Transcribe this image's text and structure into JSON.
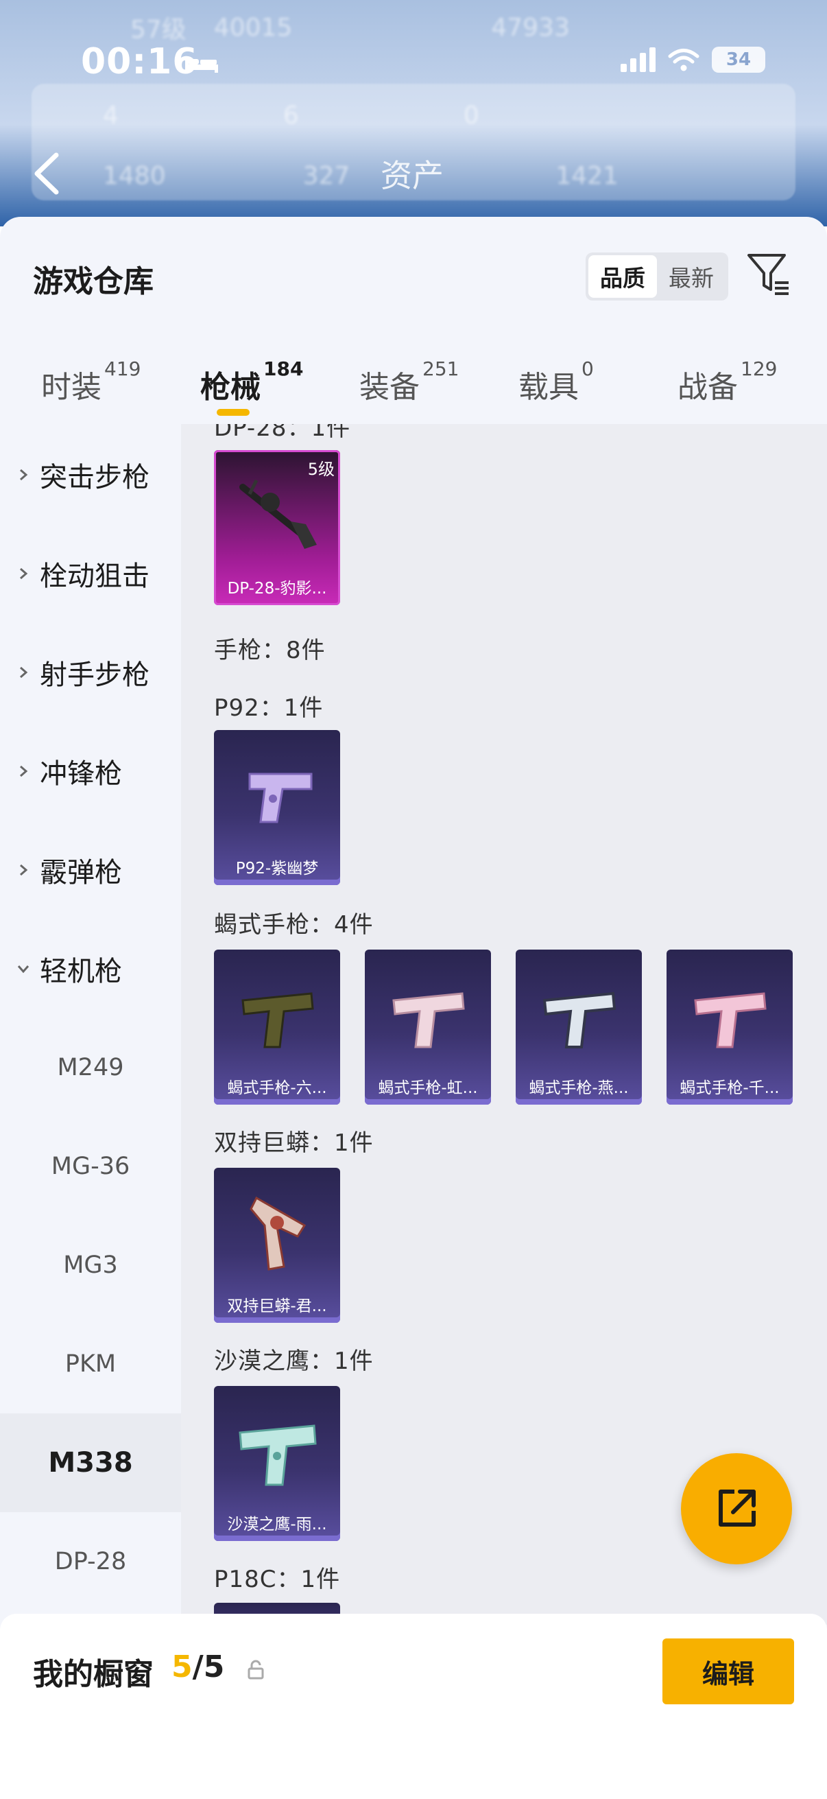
{
  "background": {
    "level": "57级",
    "coins": "40015",
    "score": "47933",
    "stats_row1": [
      "4",
      "6",
      "0"
    ],
    "stats_row2": [
      "1480",
      "327",
      "1421"
    ],
    "page_title": "资产"
  },
  "status_bar": {
    "time": "00:16",
    "battery": "34"
  },
  "sheet": {
    "title": "游戏仓库",
    "sort_quality": "品质",
    "sort_latest": "最新"
  },
  "tabs": [
    {
      "label": "时装",
      "count": "419"
    },
    {
      "label": "枪械",
      "count": "184"
    },
    {
      "label": "装备",
      "count": "251"
    },
    {
      "label": "载具",
      "count": "0"
    },
    {
      "label": "战备",
      "count": "129"
    }
  ],
  "categories": [
    "突击步枪",
    "栓动狙击",
    "射手步枪",
    "冲锋枪",
    "霰弹枪",
    "轻机枪"
  ],
  "subcategories": [
    "M249",
    "MG-36",
    "MG3",
    "PKM",
    "M338",
    "DP-28"
  ],
  "content": {
    "top_cut_label": "DP-28：1件",
    "dp28_item": {
      "name": "DP-28-豹影...",
      "level": "5级"
    },
    "pistol_header": "手枪：8件",
    "p92_header": "P92：1件",
    "p92_item": "P92-紫幽梦",
    "scorpion_header": "蝎式手枪：4件",
    "scorpion_items": [
      "蝎式手枪-六...",
      "蝎式手枪-虹...",
      "蝎式手枪-燕...",
      "蝎式手枪-千..."
    ],
    "dual_header": "双持巨蟒：1件",
    "dual_item": "双持巨蟒-君...",
    "deagle_header": "沙漠之鹰：1件",
    "deagle_item": "沙漠之鹰-雨...",
    "p18c_header": "P18C：1件"
  },
  "bottom": {
    "title": "我的橱窗",
    "current": "5",
    "total": "/5",
    "edit": "编辑"
  },
  "colors": {
    "accent": "#f5b700",
    "fab": "#f9ad00",
    "card_purple": "#3b336e",
    "card_pink": "#a01d95"
  }
}
